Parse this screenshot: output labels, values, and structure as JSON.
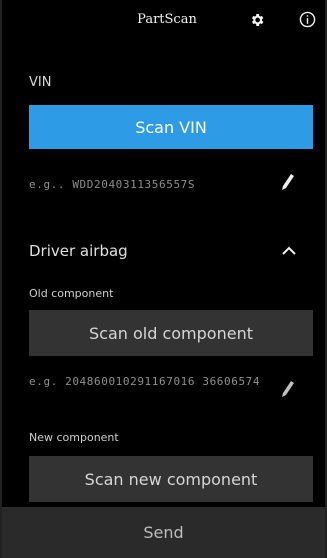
{
  "app": {
    "title": "PartScan"
  },
  "icons": {
    "settings": "gear-icon",
    "info": "info-icon",
    "edit": "pencil-icon",
    "collapse": "chevron-up-icon"
  },
  "colors": {
    "accent": "#2d9be6",
    "background": "#000000",
    "dark_button": "#333333",
    "send_bar": "#2a2a2a"
  },
  "vin": {
    "label": "VIN",
    "scan_button": "Scan VIN",
    "placeholder": "e.g.. WDD2040311356557S"
  },
  "driver_airbag": {
    "title": "Driver airbag",
    "old_component": {
      "label": "Old component",
      "scan_button": "Scan old component",
      "placeholder": "e.g. 204860010291167016 36606574"
    },
    "new_component": {
      "label": "New component",
      "scan_button": "Scan new component"
    }
  },
  "footer": {
    "send_label": "Send"
  }
}
